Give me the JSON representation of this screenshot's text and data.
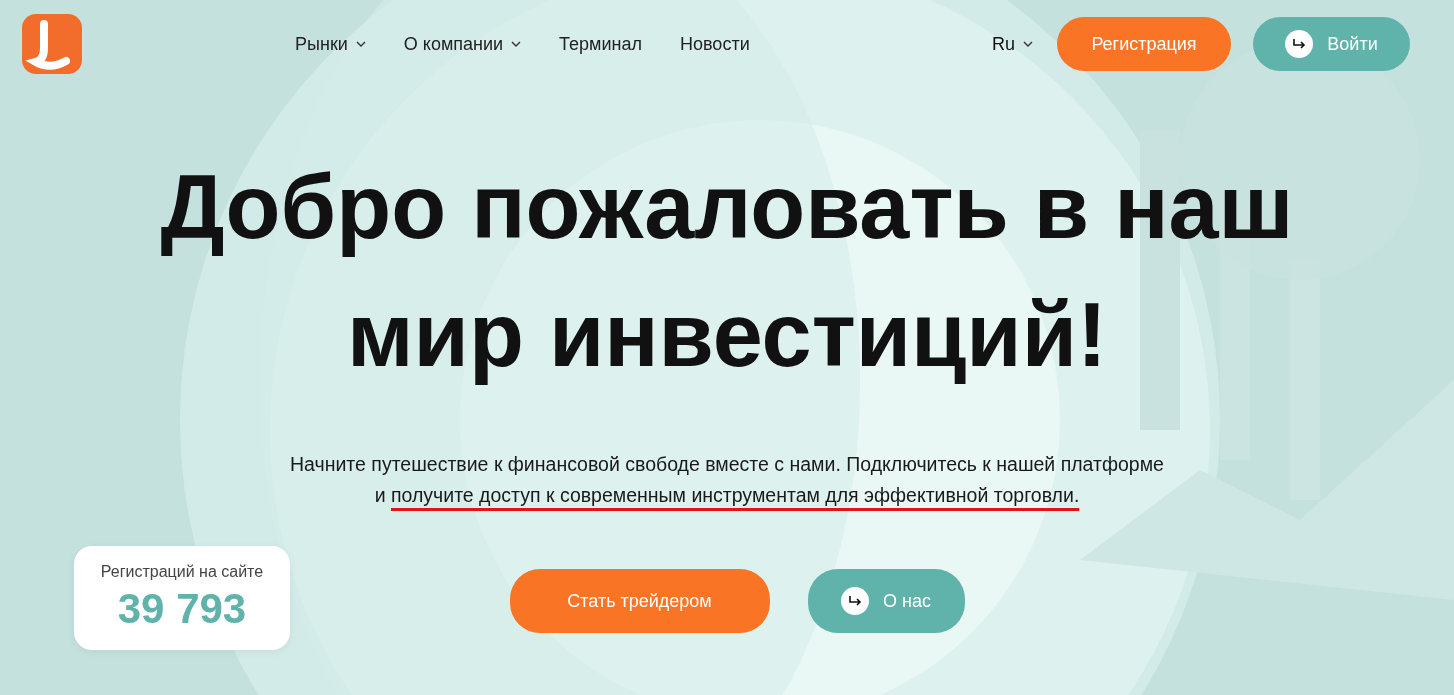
{
  "nav": {
    "items": [
      {
        "label": "Рынки",
        "dropdown": true
      },
      {
        "label": "О компании",
        "dropdown": true
      },
      {
        "label": "Терминал",
        "dropdown": false
      },
      {
        "label": "Новости",
        "dropdown": false
      }
    ],
    "language": "Ru",
    "register": "Регистрация",
    "login": "Войти"
  },
  "hero": {
    "title": [
      "Добро пожаловать в наш",
      "мир инвестиций!"
    ],
    "subtitle": "Начните путешествие к финансовой свободе вместе с нами. Подключитесь к нашей платформе и ",
    "subtitle_underlined": "получите доступ к современным инструментам для эффективной торговли.",
    "primary_button": "Стать трейдером",
    "secondary_button": "О нас"
  },
  "stats": {
    "label": "Регистраций на сайте",
    "value": "39 793"
  }
}
